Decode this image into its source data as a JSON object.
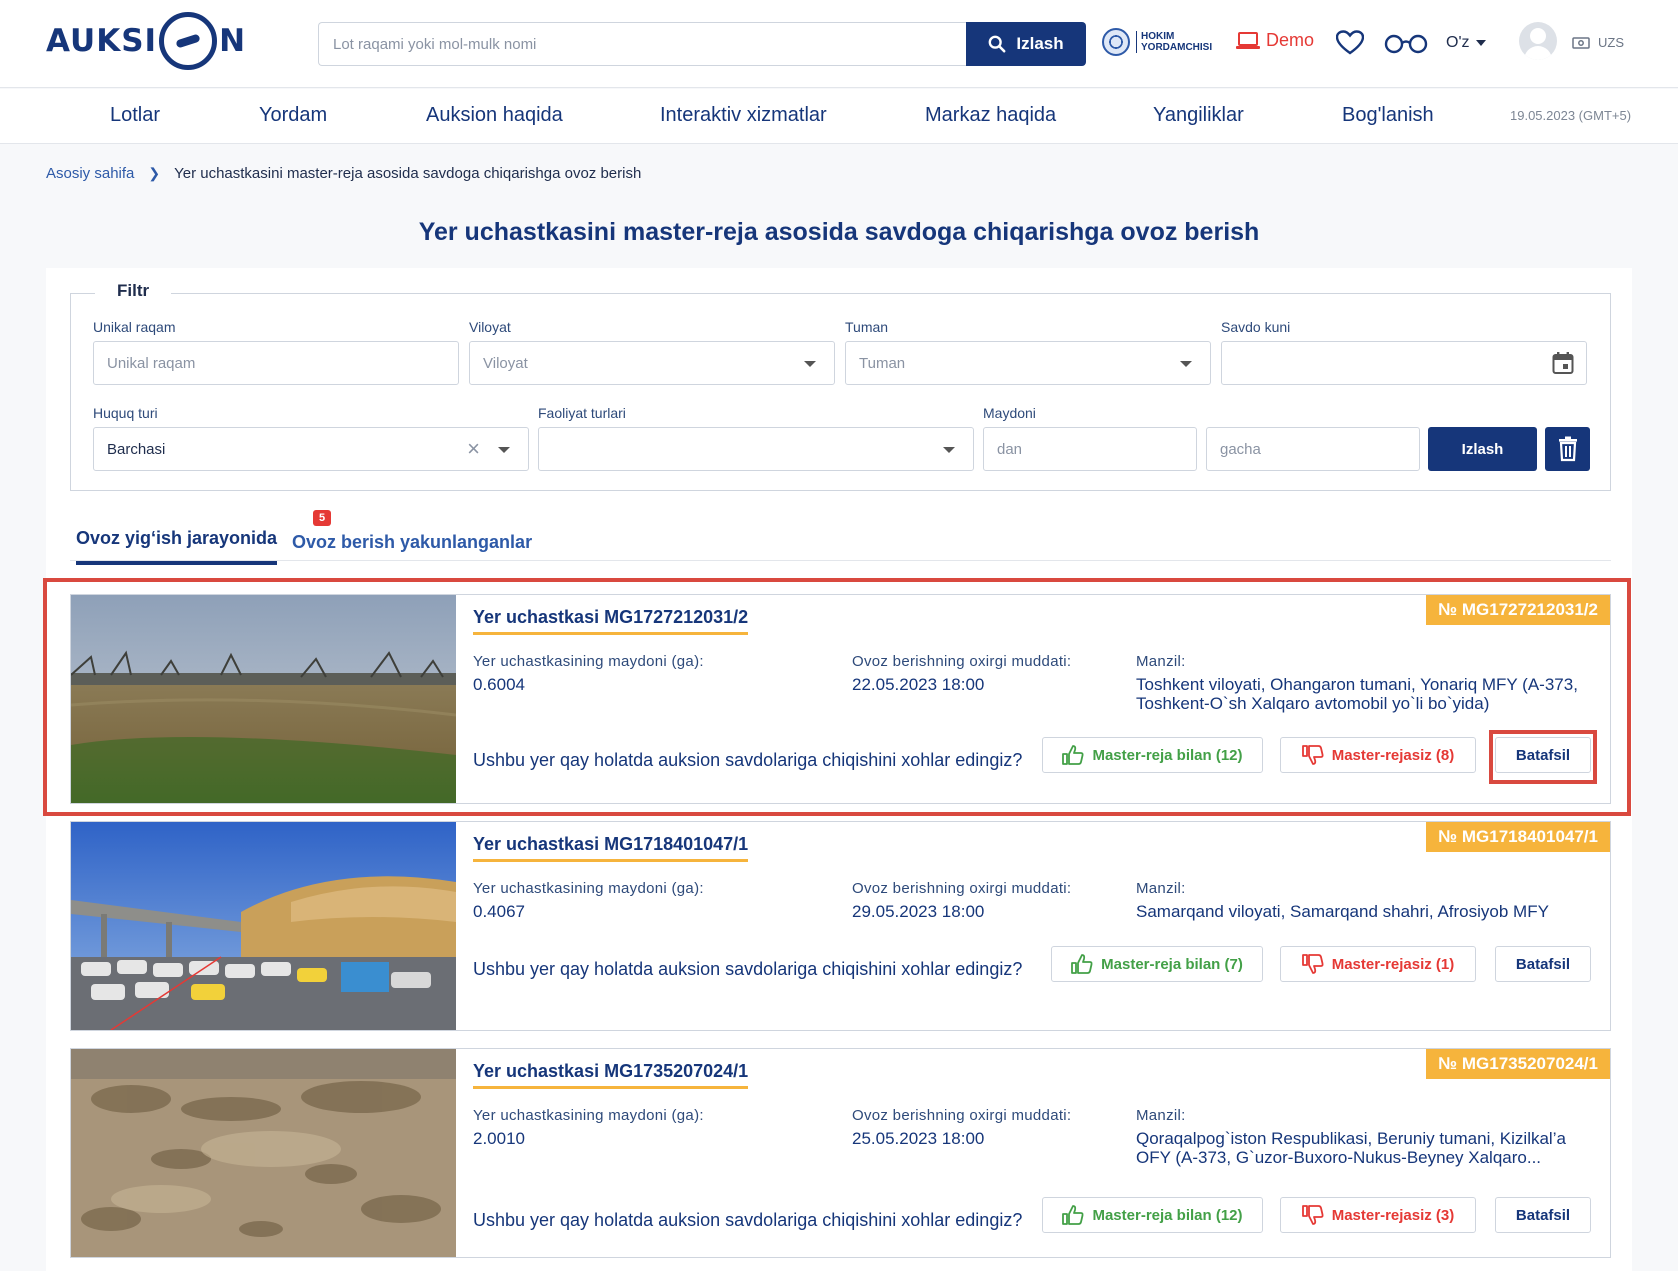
{
  "header": {
    "logo_text": "AUKSI N",
    "search_placeholder": "Lot raqami yoki mol-mulk nomi",
    "search_button": "Izlash",
    "hokim_line1": "HOKIM",
    "hokim_line2": "YORDAMCHISI",
    "demo_label": "Demo",
    "language": "O'z",
    "currency": "UZS"
  },
  "nav": {
    "items": [
      "Lotlar",
      "Yordam",
      "Auksion haqida",
      "Interaktiv xizmatlar",
      "Markaz haqida",
      "Yangiliklar",
      "Bog'lanish"
    ],
    "date": "19.05.2023 (GMT+5)"
  },
  "breadcrumb": {
    "home": "Asosiy sahifa",
    "current": "Yer uchastkasini master-reja asosida savdoga chiqarishga ovoz berish"
  },
  "page_title": "Yer uchastkasini master-reja asosida savdoga chiqarishga ovoz berish",
  "filter": {
    "legend": "Filtr",
    "unique_label": "Unikal raqam",
    "unique_placeholder": "Unikal raqam",
    "region_label": "Viloyat",
    "region_placeholder": "Viloyat",
    "district_label": "Tuman",
    "district_placeholder": "Tuman",
    "date_label": "Savdo kuni",
    "right_type_label": "Huquq turi",
    "right_type_value": "Barchasi",
    "activity_label": "Faoliyat turlari",
    "area_label": "Maydoni",
    "area_from_placeholder": "dan",
    "area_to_placeholder": "gacha",
    "search_button": "Izlash"
  },
  "tabs": {
    "active": "Ovoz yig‘ish jarayonida",
    "active_badge": "5",
    "inactive": "Ovoz berish yakunlanganlar"
  },
  "labels": {
    "area": "Yer uchastkasining maydoni (ga):",
    "deadline": "Ovoz berishning oxirgi muddati:",
    "address": "Manzil:",
    "question": "Ushbu yer qay holatda auksion savdolariga chiqishini xohlar edingiz?",
    "more": "Batafsil"
  },
  "lots": [
    {
      "number": "№ MG1727212031/2",
      "title": "Yer uchastkasi MG1727212031/2",
      "area": "0.6004",
      "deadline": "22.05.2023 18:00",
      "address": "Toshkent viloyati, Ohangaron tumani, Yonariq MFY (A-373, Toshkent-O`sh Xalqaro avtomobil yo`li bo`yida)",
      "yes": "Master-reja bilan (12)",
      "no": "Master-rejasiz (8)"
    },
    {
      "number": "№ MG1718401047/1",
      "title": "Yer uchastkasi MG1718401047/1",
      "area": "0.4067",
      "deadline": "29.05.2023 18:00",
      "address": "Samarqand viloyati, Samarqand shahri, Afrosiyob MFY",
      "yes": "Master-reja bilan (7)",
      "no": "Master-rejasiz (1)"
    },
    {
      "number": "№ MG1735207024/1",
      "title": "Yer uchastkasi MG1735207024/1",
      "area": "2.0010",
      "deadline": "25.05.2023 18:00",
      "address": "Qoraqalpog`iston Respublikasi, Beruniy tumani, Kizilkal’a OFY (A-373, G`uzor-Buxoro-Nukus-Beyney Xalqaro...",
      "yes": "Master-reja bilan (12)",
      "no": "Master-rejasiz (3)"
    }
  ]
}
